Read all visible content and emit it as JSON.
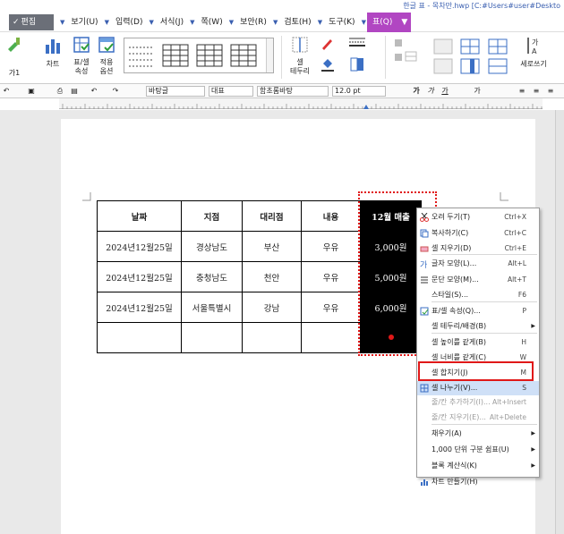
{
  "window": {
    "title": "한글 표 - 목차만.hwp [C:#Users#user#Deskto"
  },
  "menu": {
    "logo_label": "편집",
    "items": [
      {
        "label": "보기(U)"
      },
      {
        "label": "입력(D)"
      },
      {
        "label": "서식(J)"
      },
      {
        "label": "쪽(W)"
      },
      {
        "label": "보안(R)"
      },
      {
        "label": "검토(H)"
      },
      {
        "label": "도구(K)"
      },
      {
        "label": "표(Q)"
      }
    ]
  },
  "ribbon": {
    "chart_label": "차트",
    "table_props_label_1": "표/셀",
    "table_props_label_2": "속성",
    "apply_options_label_1": "적용",
    "apply_options_label_2": "옵션",
    "cell_border_label_1": "셀",
    "cell_border_label_2": "테두리",
    "vertical_writing_label": "세로쓰기",
    "left_partial_label": "가1"
  },
  "format_toolbar": {
    "style_value": "바탕글",
    "style_kind_value": "대표",
    "font_value": "함초롬바탕",
    "font_size_value": "12.0",
    "font_size_unit": "pt",
    "bold_label": "가",
    "italic_label": "가",
    "underline_label": "가",
    "strike_label": "가"
  },
  "table": {
    "headers": [
      "날짜",
      "지점",
      "대리점",
      "내용",
      "12월 매출"
    ],
    "rows": [
      [
        "2024년12월25일",
        "경상남도",
        "부산",
        "우유",
        "3,000원"
      ],
      [
        "2024년12월25일",
        "충청남도",
        "천안",
        "우유",
        "5,000원"
      ],
      [
        "2024년12월25일",
        "서울특별시",
        "강남",
        "우유",
        "6,000원"
      ]
    ]
  },
  "context_menu": {
    "items": [
      {
        "label": "오려 두기(T)",
        "shortcut": "Ctrl+X",
        "icon": "scissors-icon"
      },
      {
        "label": "복사하기(C)",
        "shortcut": "Ctrl+C",
        "icon": "copy-icon"
      },
      {
        "label": "셀 지우기(D)",
        "shortcut": "Ctrl+E",
        "icon": "erase-icon"
      },
      {
        "label": "글자 모양(L)...",
        "shortcut": "Alt+L",
        "icon": "char-shape-icon"
      },
      {
        "label": "문단 모양(M)...",
        "shortcut": "Alt+T",
        "icon": "paragraph-shape-icon"
      },
      {
        "label": "스타일(S)...",
        "shortcut": "F6",
        "icon": "style-icon"
      },
      {
        "label": "표/셀 속성(Q)...",
        "shortcut": "P",
        "icon": "table-props-icon"
      },
      {
        "label": "셀 테두리/배경(B)",
        "shortcut": "",
        "icon": "cell-border-icon"
      },
      {
        "label": "셀 높이를 같게(B)",
        "shortcut": "H",
        "icon": "equal-height-icon"
      },
      {
        "label": "셀 너비를 같게(C)",
        "shortcut": "W",
        "icon": "equal-width-icon"
      },
      {
        "label": "셀 합치기(J)",
        "shortcut": "M",
        "icon": "merge-icon"
      },
      {
        "label": "셀 나누기(V)...",
        "shortcut": "S",
        "icon": "split-icon"
      },
      {
        "label": "줄/칸 추가하기(I)...",
        "shortcut": "Alt+Insert",
        "icon": ""
      },
      {
        "label": "줄/칸 지우기(E)...",
        "shortcut": "Alt+Delete",
        "icon": ""
      },
      {
        "label": "채우기(A)",
        "shortcut": "",
        "icon": ""
      },
      {
        "label": "1,000 단위 구분 쉼표(U)",
        "shortcut": "",
        "icon": ""
      },
      {
        "label": "블록 계산식(K)",
        "shortcut": "",
        "icon": ""
      },
      {
        "label": "차트 만들기(H)",
        "shortcut": "",
        "icon": "chart-icon"
      }
    ]
  },
  "colors": {
    "accent": "#b146c2",
    "highlight_border": "#e01818",
    "selection_cell_bg": "#000000",
    "menu_hover": "#cfe0f7"
  }
}
